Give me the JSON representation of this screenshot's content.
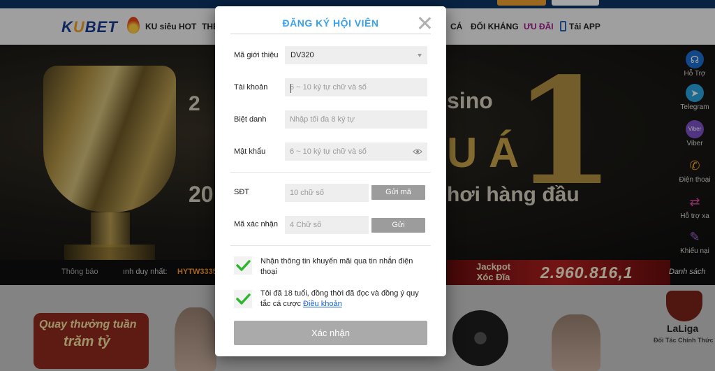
{
  "header": {
    "logo_text": "KUBET",
    "nav": {
      "hot": "KU siêu HOT",
      "partial_left": "THỂ",
      "partial_right": "CÁ",
      "duel": "ĐỐI KHÁNG",
      "promo": "ƯU ĐÃI",
      "app": "Tải APP"
    }
  },
  "banner": {
    "text_casino": "sino",
    "text_a": "U Á",
    "text_one": "1",
    "text_20": "20",
    "text_leading": "hơi hàng đầu",
    "text_2": "2"
  },
  "ticker": {
    "notice": "Thông báo",
    "winner_label": "ınh duy nhất:",
    "winner_id": "HYTW3335"
  },
  "jackpot": {
    "label_line1": "Jackpot",
    "label_line2": "Xóc Đĩa",
    "value": "2.960.816,1",
    "list_link": "Danh sách"
  },
  "sidebar": {
    "support": "Hỗ Trợ",
    "telegram": "Telegram",
    "viber_badge": "Viber",
    "viber": "Viber",
    "phone": "Điện thoại",
    "transfer": "Hỗ trợ xa",
    "complaint": "Khiếu nại"
  },
  "promos": {
    "weekly_line1": "Quay thưởng tuần",
    "weekly_line2": "trăm tỷ",
    "laliga_name": "LaLiga",
    "laliga_sub": "Đối Tác Chính Thức"
  },
  "modal": {
    "title": "ĐĂNG KÝ HỘI VIÊN",
    "referral": {
      "label": "Mã giới thiệu",
      "value": "DV320"
    },
    "account": {
      "label": "Tài khoản",
      "placeholder": "6 ~ 10 ký tự chữ và số"
    },
    "nickname": {
      "label": "Biệt danh",
      "placeholder": "Nhập tối đa 8 ký tự"
    },
    "password": {
      "label": "Mật khẩu",
      "placeholder": "6 ~ 10 ký tự chữ và số"
    },
    "phone": {
      "label": "SĐT",
      "placeholder": "10 chữ số",
      "button": "Gửi mã"
    },
    "captcha": {
      "label": "Mã xác nhận",
      "placeholder": "4 Chữ số",
      "button": "Gửi"
    },
    "consent_sms": "Nhận thông tin khuyến mãi qua tin nhắn điện thoại",
    "consent_age": "Tôi đã 18 tuổi, đồng thời đã đọc và đồng ý quy tắc cá cược ",
    "terms_link": "Điều khoản",
    "submit": "Xác nhận"
  },
  "colors": {
    "title_blue": "#3aa1e8",
    "check_green": "#2fb52f",
    "button_gray": "#aaaaaa",
    "promo_purple": "#a01b8a"
  }
}
